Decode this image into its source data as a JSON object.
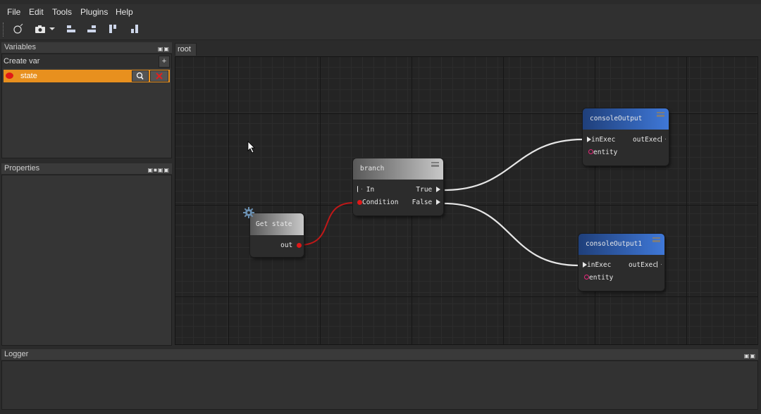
{
  "menu": [
    "File",
    "Edit",
    "Tools",
    "Plugins",
    "Help"
  ],
  "toolbar": {
    "icons": [
      "new-graph-icon",
      "camera-icon",
      "dropdown-arrow-icon",
      "align-left-icon",
      "align-right-icon",
      "align-top-icon",
      "align-bottom-icon"
    ]
  },
  "variables": {
    "title": "Variables",
    "create_label": "Create var",
    "add_label": "+",
    "items": [
      {
        "name": "state",
        "color": "#e01818"
      }
    ],
    "row_color": "#e8901e"
  },
  "properties": {
    "title": "Properties"
  },
  "tab": {
    "label": "root"
  },
  "logger": {
    "title": "Logger"
  },
  "nodes": {
    "branch": {
      "title": "branch",
      "in": "In",
      "condition": "Condition",
      "true": "True",
      "false": "False"
    },
    "get_state": {
      "title": "Get state",
      "out": "out"
    },
    "console0": {
      "title": "consoleOutput",
      "in_exec": "inExec",
      "out_exec": "outExec",
      "entity": "entity"
    },
    "console1": {
      "title": "consoleOutput1",
      "in_exec": "inExec",
      "out_exec": "outExec",
      "entity": "entity"
    }
  },
  "colors": {
    "accent": "#e8901e",
    "node_blue": "#3f78d8",
    "bool_pin": "#e01818",
    "entity_pin": "#e8287a",
    "wire_exec": "#e6e6e6",
    "wire_bool": "#c01818"
  }
}
